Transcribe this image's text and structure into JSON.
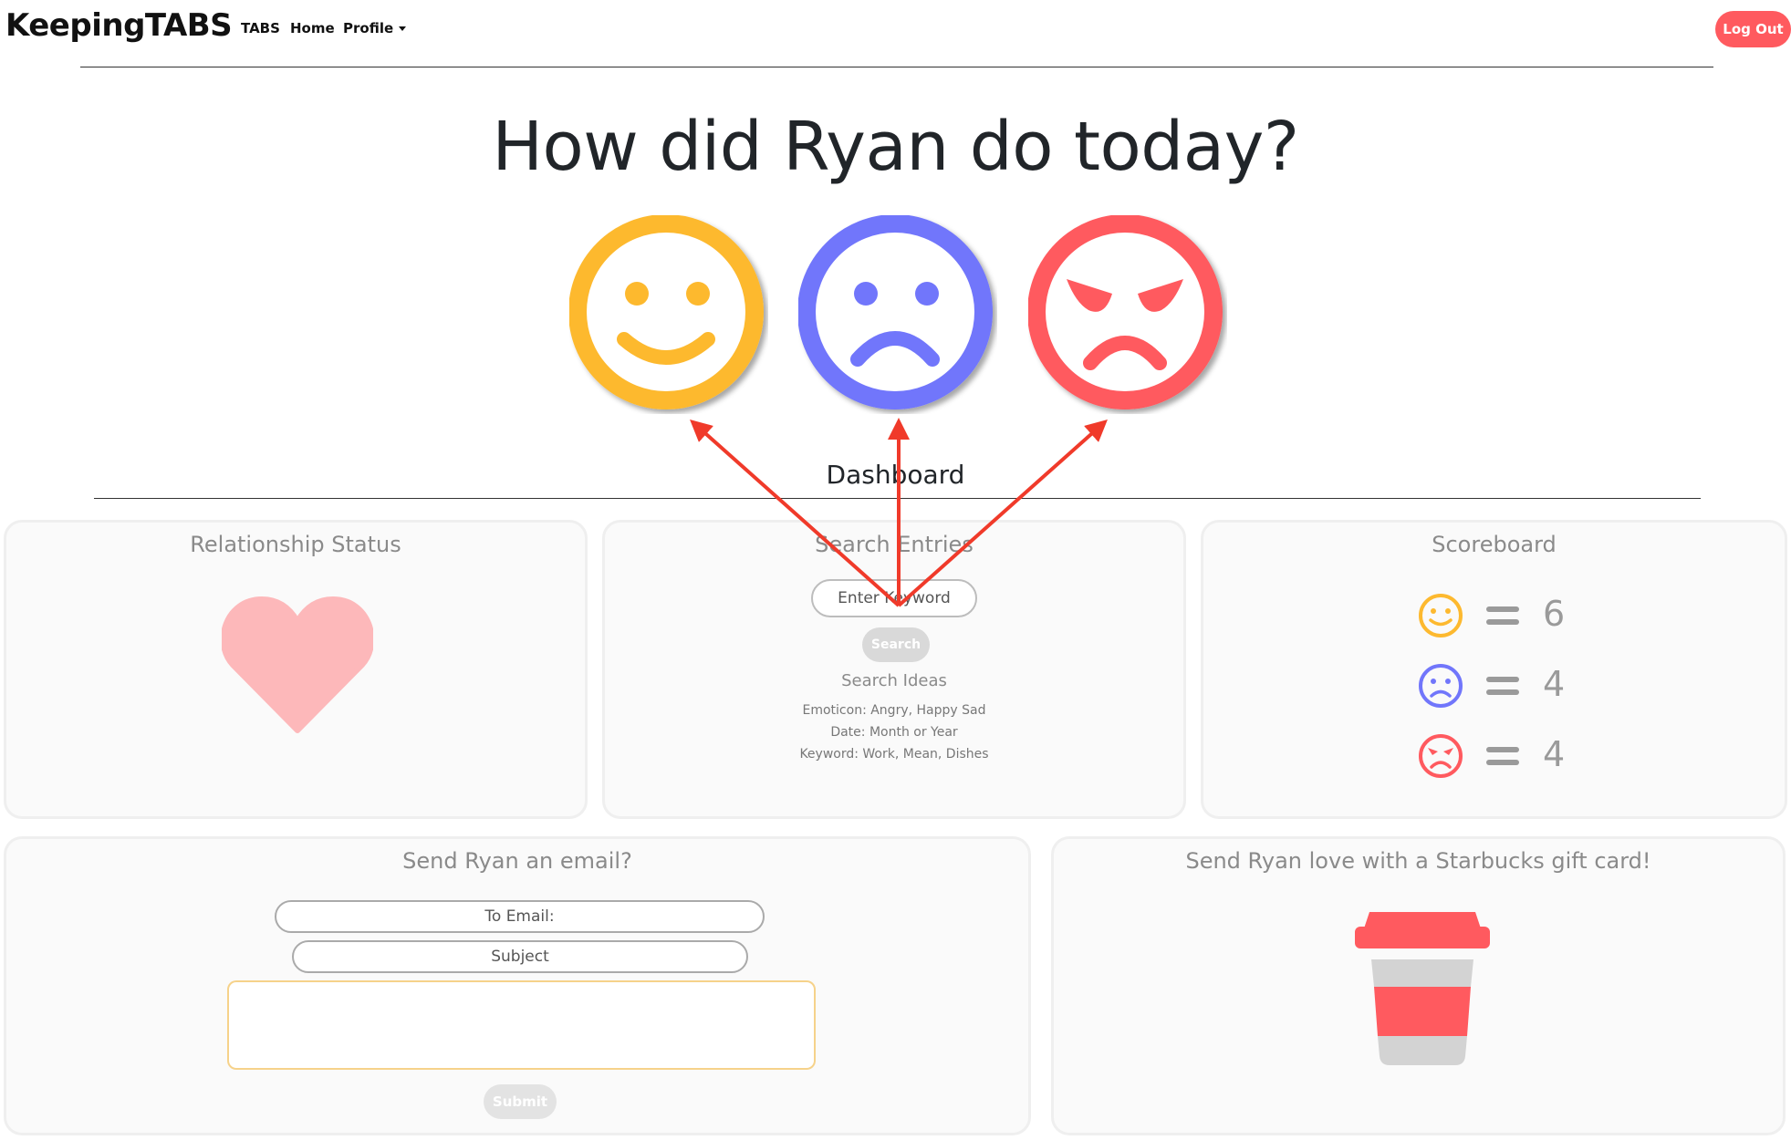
{
  "nav": {
    "brand": "KeepingTABS",
    "links": [
      "TABS",
      "Home",
      "Profile"
    ],
    "logout_label": "Log Out"
  },
  "hero": {
    "title": "How did Ryan do today?",
    "emotions": [
      "happy",
      "sad",
      "angry"
    ]
  },
  "dashboard": {
    "title": "Dashboard"
  },
  "relationship": {
    "title": "Relationship Status",
    "icon": "heart-icon"
  },
  "search": {
    "title": "Search Entries",
    "placeholder": "Enter Keyword",
    "button_label": "Search",
    "ideas_title": "Search Ideas",
    "ideas": [
      "Emoticon: Angry, Happy Sad",
      "Date: Month or Year",
      "Keyword: Work, Mean, Dishes"
    ]
  },
  "scoreboard": {
    "title": "Scoreboard",
    "rows": [
      {
        "emotion": "happy",
        "count": "6"
      },
      {
        "emotion": "sad",
        "count": "4"
      },
      {
        "emotion": "angry",
        "count": "4"
      }
    ]
  },
  "email": {
    "title": "Send Ryan an email?",
    "to_placeholder": "To Email:",
    "subject_placeholder": "Subject",
    "body_value": "",
    "submit_label": "Submit"
  },
  "gift": {
    "title": "Send Ryan love with a Starbucks gift card!",
    "icon": "coffee-cup-icon"
  },
  "colors": {
    "happy": "#FDB92F",
    "sad": "#7176FB",
    "angry": "#FF5A5F",
    "heart": "#FDB8BA",
    "logout": "#FF5A5F",
    "annotation_arrow": "#F03A2A"
  }
}
